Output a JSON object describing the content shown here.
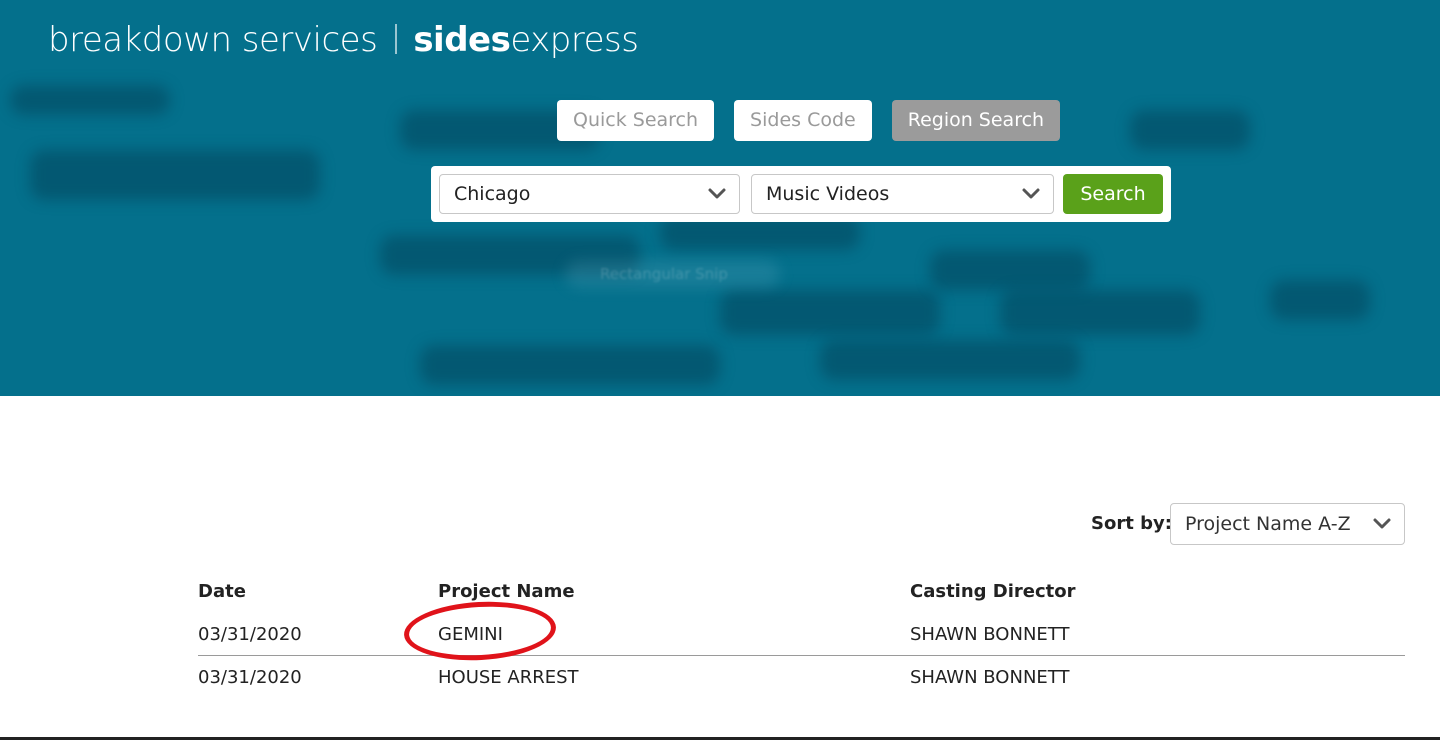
{
  "brand": {
    "part1": "breakdown services",
    "part2_bold": "sides",
    "part2_rest": "express"
  },
  "search_modes": [
    "Quick Search",
    "Sides Code",
    "Region Search"
  ],
  "active_mode": "Region Search",
  "search": {
    "region_value": "Chicago",
    "category_value": "Music Videos",
    "button_label": "Search"
  },
  "background_caption": "Rectangular Snip",
  "sort": {
    "label": "Sort by:",
    "value": "Project Name A-Z"
  },
  "table": {
    "headers": {
      "date": "Date",
      "project": "Project Name",
      "director": "Casting Director"
    },
    "rows": [
      {
        "date": "03/31/2020",
        "project": "GEMINI",
        "director": "SHAWN BONNETT"
      },
      {
        "date": "03/31/2020",
        "project": "HOUSE ARREST",
        "director": "SHAWN BONNETT"
      }
    ]
  },
  "colors": {
    "hero_bg": "#04708c",
    "search_button": "#5aa11a",
    "active_tab": "#9b9b9b",
    "annotation_circle": "#e0131a"
  }
}
